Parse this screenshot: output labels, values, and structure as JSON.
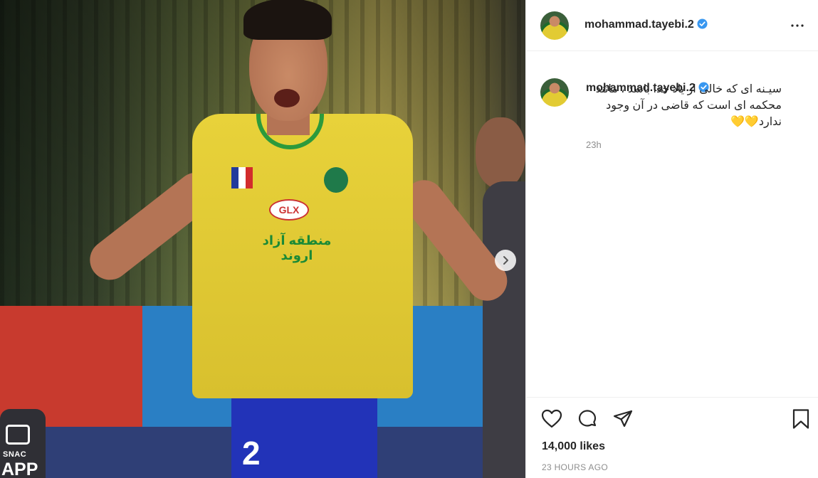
{
  "post": {
    "username": "mohammad.tayebi.2",
    "caption": "سیـنه ای که خالی از یاد خدا باشد ، مانند محکمه ای است که قاضی در آن وجود ندارد",
    "caption_emoji": "💛💛",
    "comment_age": "23h",
    "likes": "14,000 likes",
    "posted_ago": "23 HOURS AGO"
  },
  "photo": {
    "jersey_sponsor": "GLX",
    "jersey_text": "منطقه آزاد اروند",
    "jersey_number": "2",
    "app_logo_line1": "SNAC",
    "app_logo_line2": "APP"
  },
  "colors": {
    "verified": "#3897f0",
    "text": "#262626",
    "muted": "#8e8e8e",
    "border": "#efefef"
  },
  "icons": {
    "more": "more-horizontal-icon",
    "like": "heart-icon",
    "comment": "comment-icon",
    "share": "paper-plane-icon",
    "save": "bookmark-icon",
    "next": "chevron-right-icon"
  }
}
